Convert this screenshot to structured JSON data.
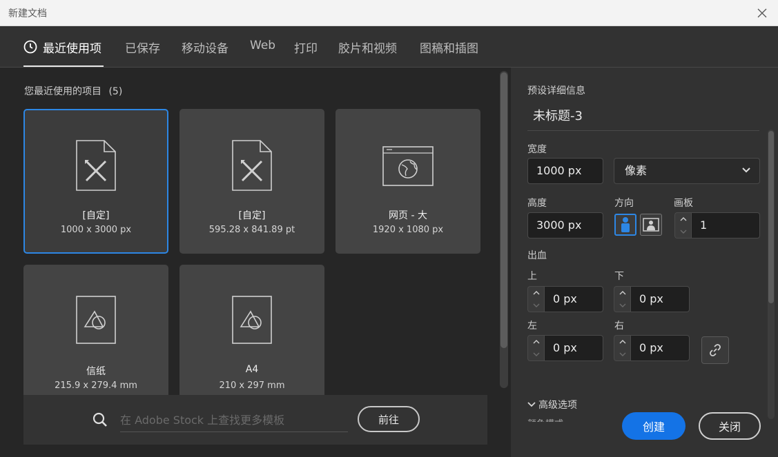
{
  "window": {
    "title": "新建文档"
  },
  "tabs": [
    {
      "label": "最近使用项",
      "active": true
    },
    {
      "label": "已保存"
    },
    {
      "label": "移动设备"
    },
    {
      "label": "Web"
    },
    {
      "label": "打印"
    },
    {
      "label": "胶片和视频"
    },
    {
      "label": "图稿和插图"
    }
  ],
  "recent": {
    "heading": "您最近使用的项目",
    "count": "(5)",
    "items": [
      {
        "name": "[自定]",
        "size": "1000 x 3000 px",
        "icon": "custom-doc-icon",
        "selected": true
      },
      {
        "name": "[自定]",
        "size": "595.28 x 841.89 pt",
        "icon": "custom-doc-icon"
      },
      {
        "name": "网页 - 大",
        "size": "1920 x 1080 px",
        "icon": "web-icon"
      },
      {
        "name": "信纸",
        "size": "215.9 x 279.4 mm",
        "icon": "print-doc-icon"
      },
      {
        "name": "A4",
        "size": "210 x 297 mm",
        "icon": "print-doc-icon"
      }
    ]
  },
  "stock": {
    "placeholder": "在 Adobe Stock 上查找更多模板",
    "go_label": "前往"
  },
  "preset": {
    "heading": "预设详细信息",
    "doc_name": "未标题-3",
    "width_label": "宽度",
    "width_value": "1000 px",
    "unit": "像素",
    "height_label": "高度",
    "height_value": "3000 px",
    "orientation_label": "方向",
    "artboards_label": "画板",
    "artboards_value": "1",
    "bleed_label": "出血",
    "bleed_top_label": "上",
    "bleed_top": "0 px",
    "bleed_bottom_label": "下",
    "bleed_bottom": "0 px",
    "bleed_left_label": "左",
    "bleed_left": "0 px",
    "bleed_right_label": "右",
    "bleed_right": "0 px",
    "advanced_label": "高级选项",
    "color_mode_label": "颜色模式"
  },
  "actions": {
    "create": "创建",
    "close": "关闭"
  },
  "colors": {
    "accent": "#1473e6",
    "selection": "#2d87e5",
    "panel": "#323232",
    "grid": "#262626"
  }
}
